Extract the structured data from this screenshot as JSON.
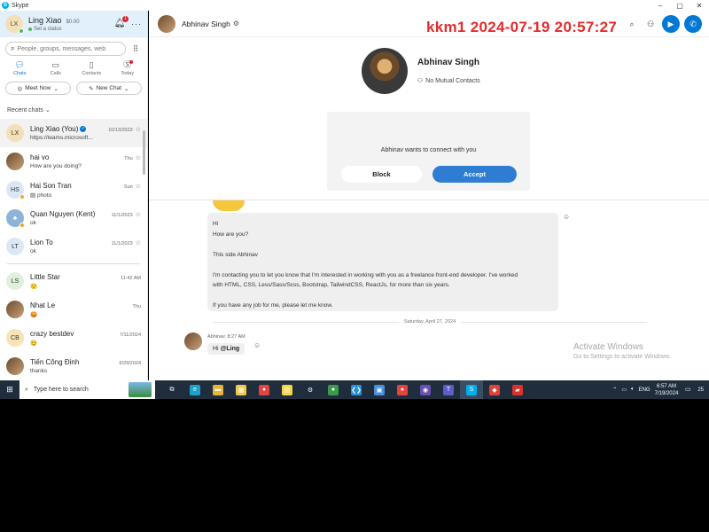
{
  "window": {
    "title": "Skype",
    "controls": [
      "–",
      "▢",
      "✕"
    ]
  },
  "profile": {
    "initials": "LX",
    "name": "Ling Xiao",
    "credit": "$0.00",
    "status": "Set a status",
    "notifications": "1",
    "more": "···"
  },
  "search": {
    "placeholder": "People, groups, messages, web"
  },
  "nav": [
    {
      "label": "Chats",
      "icon": "chat-icon"
    },
    {
      "label": "Calls",
      "icon": "calls-icon"
    },
    {
      "label": "Contacts",
      "icon": "contacts-icon"
    },
    {
      "label": "Today",
      "icon": "today-icon"
    }
  ],
  "actions": {
    "meet_now": "Meet Now",
    "new_chat": "New Chat"
  },
  "recent_label": "Recent chats",
  "chats": [
    {
      "initials": "LX",
      "name": "Ling Xiao (You)",
      "time": "10/13/2023",
      "preview": "https://teams.microsoft...",
      "color": "#f3e0b8"
    },
    {
      "initials": "",
      "name": "hai vo",
      "time": "Thu",
      "preview": "How are you doing?",
      "color": "#7a5230"
    },
    {
      "initials": "HS",
      "name": "Hai Son Tran",
      "time": "Sun",
      "preview": "photo",
      "color": "#dbe7f5"
    },
    {
      "initials": "",
      "name": "Quan Nguyen (Kent)",
      "time": "11/1/2023",
      "preview": "ok",
      "color": "#8db3d9"
    },
    {
      "initials": "LT",
      "name": "Lion To",
      "time": "11/1/2023",
      "preview": "ok",
      "color": "#dbe7f5"
    },
    {
      "initials": "LS",
      "name": "Little Star",
      "time": "11:42 AM",
      "preview": "",
      "color": "#dff1dc"
    },
    {
      "initials": "",
      "name": "Nhat Le",
      "time": "Thu",
      "preview": "",
      "color": "#9a6a45"
    },
    {
      "initials": "CB",
      "name": "crazy bestdev",
      "time": "7/11/2024",
      "preview": "",
      "color": "#f7e3b5"
    },
    {
      "initials": "",
      "name": "Tiến Công Đinh",
      "time": "6/29/2024",
      "preview": "thanks",
      "color": "#a07a55"
    }
  ],
  "conversation": {
    "name": "Abhinav Singh",
    "mutual": "No Mutual Contacts",
    "watermark": "kkm1 2024-07-19 20:57:27",
    "request_text": "Abhinav wants to connect with you",
    "block_label": "Block",
    "accept_label": "Accept",
    "message_lines": [
      "Hi",
      "How are you?",
      "",
      "This side Abhinav",
      "",
      "I'm contacting you to let you know that I'm interested in working with you as a freelance front-end developer. I've worked",
      "with HTML, CSS, Less/Sass/Scss, Bootstrap, TailwindCSS, ReactJs, for more than six years.",
      "",
      "If you have any job for me, please let me know."
    ],
    "date_separator": "Saturday, April 27, 2024",
    "msg2_meta": "Abhinav, 8:27 AM",
    "msg2_text_prefix": "Hi ",
    "msg2_mention": "@Ling"
  },
  "activate": {
    "title": "Activate Windows",
    "subtitle": "Go to Settings to activate Windows."
  },
  "taskbar": {
    "search_placeholder": "Type here to search",
    "lang": "ENG",
    "time": "6:57 AM",
    "date": "7/19/2024",
    "notif_count": "25",
    "apps": [
      {
        "name": "task-view",
        "color": "#1f2d3d",
        "glyph": "⧉"
      },
      {
        "name": "edge",
        "color": "#1aa3c9",
        "glyph": "e"
      },
      {
        "name": "file-explorer",
        "color": "#e8b53a",
        "glyph": "▬"
      },
      {
        "name": "store",
        "color": "#f2c94c",
        "glyph": "▦"
      },
      {
        "name": "chrome-1",
        "color": "#e2453c",
        "glyph": "●"
      },
      {
        "name": "sticky-notes",
        "color": "#f5d547",
        "glyph": "▤"
      },
      {
        "name": "settings",
        "color": "#1f2d3d",
        "glyph": "⚙"
      },
      {
        "name": "chrome-2",
        "color": "#3c9a4a",
        "glyph": "●"
      },
      {
        "name": "vscode",
        "color": "#2b8fd6",
        "glyph": "❮❯"
      },
      {
        "name": "app-blue",
        "color": "#4a90d9",
        "glyph": "▣"
      },
      {
        "name": "chrome-3",
        "color": "#e2453c",
        "glyph": "●"
      },
      {
        "name": "github-desktop",
        "color": "#6a4fb0",
        "glyph": "◉"
      },
      {
        "name": "teams",
        "color": "#5b5fc7",
        "glyph": "T"
      },
      {
        "name": "skype",
        "color": "#00aff0",
        "glyph": "S"
      },
      {
        "name": "anydesk",
        "color": "#e0413a",
        "glyph": "◆"
      },
      {
        "name": "app-red",
        "color": "#d9342b",
        "glyph": "▰"
      }
    ]
  }
}
